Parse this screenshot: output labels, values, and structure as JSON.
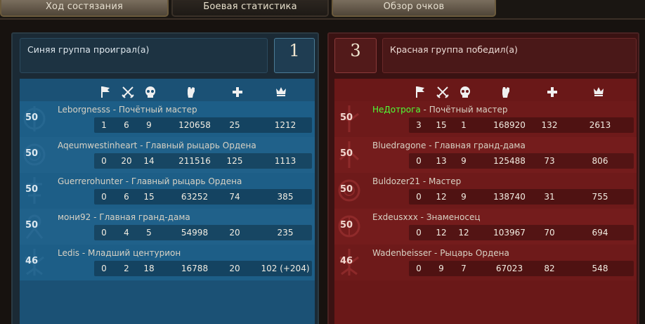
{
  "tabs": [
    {
      "label": "Ход состязания"
    },
    {
      "label": "Боевая статистика"
    },
    {
      "label": "Обзор очков"
    }
  ],
  "blue": {
    "header": "Синяя группа проиграл(а)",
    "score": "1",
    "icons": [
      "flag-icon",
      "crossed-swords-icon",
      "skull-icon",
      "fist-icon",
      "plus-icon",
      "crown-icon"
    ],
    "players": [
      {
        "level": "50",
        "name": "Leborgnesss",
        "title": "Почётный мастер",
        "stats": [
          "1",
          "6",
          "9",
          "120658",
          "25",
          "1212"
        ]
      },
      {
        "level": "50",
        "name": "Aqeumwestinheart",
        "title": "Главный рыцарь Ордена",
        "stats": [
          "0",
          "20",
          "14",
          "211516",
          "125",
          "1113"
        ]
      },
      {
        "level": "50",
        "name": "Guerrerohunter",
        "title": "Главный рыцарь Ордена",
        "stats": [
          "0",
          "6",
          "15",
          "63252",
          "74",
          "385"
        ]
      },
      {
        "level": "50",
        "name": "мони92",
        "title": "Главная гранд-дама",
        "stats": [
          "0",
          "4",
          "5",
          "54998",
          "20",
          "235"
        ]
      },
      {
        "level": "46",
        "name": "Ledis",
        "title": "Младший центурион",
        "stats": [
          "0",
          "2",
          "18",
          "16788",
          "20",
          "102 (+204)"
        ]
      }
    ]
  },
  "red": {
    "header": "Красная группа победил(а)",
    "score": "3",
    "icons": [
      "flag-icon",
      "crossed-swords-icon",
      "skull-icon",
      "fist-icon",
      "plus-icon",
      "crown-icon"
    ],
    "players": [
      {
        "level": "50",
        "name": "НеДотрога",
        "title": "Почётный мастер",
        "stats": [
          "3",
          "15",
          "1",
          "168920",
          "132",
          "2613"
        ]
      },
      {
        "level": "50",
        "name": "Bluedragone",
        "title": "Главная гранд-дама",
        "stats": [
          "0",
          "13",
          "9",
          "125488",
          "73",
          "806"
        ]
      },
      {
        "level": "50",
        "name": "Buldozer21",
        "title": "Мастер",
        "stats": [
          "0",
          "12",
          "9",
          "138740",
          "31",
          "755"
        ]
      },
      {
        "level": "50",
        "name": "Exdeusxxx",
        "title": "Знаменосец",
        "stats": [
          "0",
          "12",
          "12",
          "103967",
          "70",
          "694"
        ]
      },
      {
        "level": "46",
        "name": "Wadenbeisser",
        "title": "Рыцарь Ордена",
        "stats": [
          "0",
          "9",
          "7",
          "67023",
          "82",
          "548"
        ]
      }
    ]
  },
  "separator": " - ",
  "colors": {
    "blue_panel": "#1b5175",
    "red_panel": "#6a1818",
    "highlight_name": "#50ff36"
  }
}
